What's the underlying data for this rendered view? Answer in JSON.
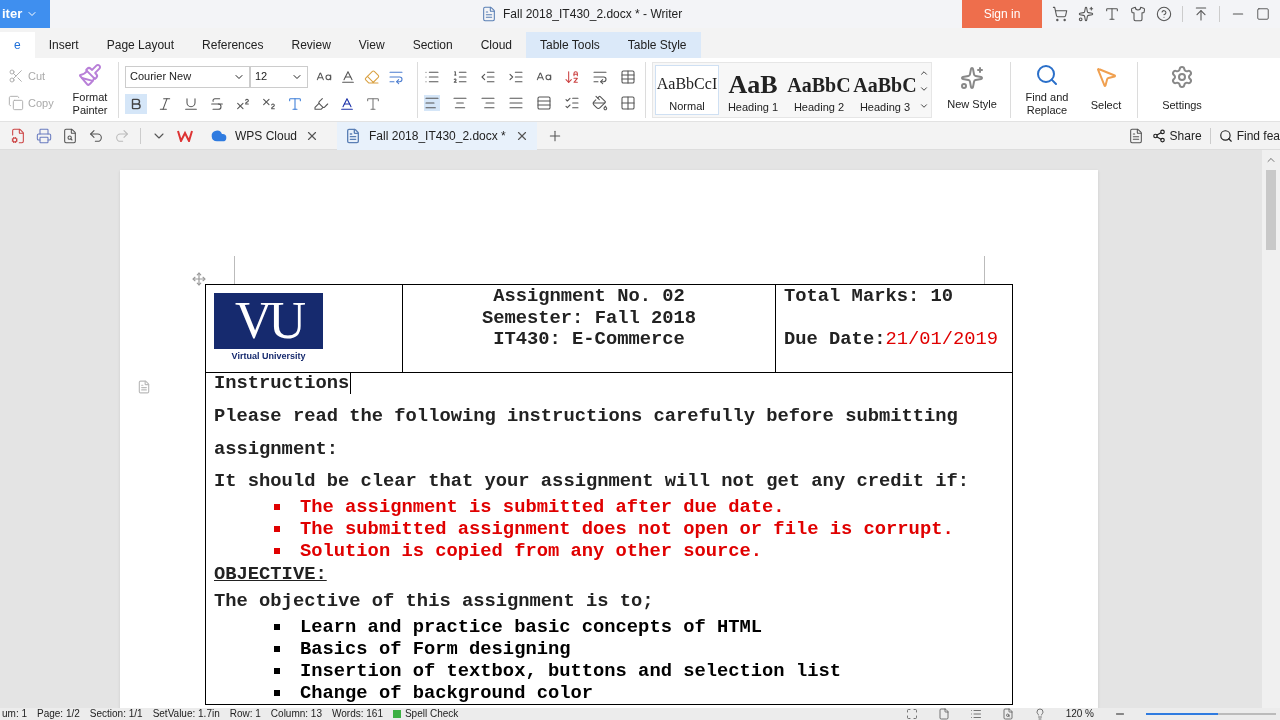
{
  "app_button": {
    "label": "iter"
  },
  "window": {
    "title": "Fall 2018_IT430_2.docx * - Writer",
    "sign_in": "Sign in"
  },
  "menu_tabs": [
    {
      "label": "e",
      "selected": true,
      "kind": "main"
    },
    {
      "label": "Insert",
      "selected": false,
      "kind": "main"
    },
    {
      "label": "Page Layout",
      "selected": false,
      "kind": "main"
    },
    {
      "label": "References",
      "selected": false,
      "kind": "main"
    },
    {
      "label": "Review",
      "selected": false,
      "kind": "main"
    },
    {
      "label": "View",
      "selected": false,
      "kind": "main"
    },
    {
      "label": "Section",
      "selected": false,
      "kind": "main"
    },
    {
      "label": "Cloud",
      "selected": false,
      "kind": "main"
    },
    {
      "label": "Table Tools",
      "selected": false,
      "kind": "context"
    },
    {
      "label": "Table Style",
      "selected": false,
      "kind": "context"
    }
  ],
  "ribbon": {
    "cut": {
      "label": "Cut",
      "disabled": true
    },
    "copy": {
      "label": "Copy",
      "disabled": true
    },
    "format_painter": "Format Painter",
    "font_name": "Courier New",
    "font_size": "12",
    "bold": {
      "selected": true
    },
    "styles": [
      {
        "preview": "AaBbCcI",
        "label": "Normal",
        "selected": true,
        "kind": "normal"
      },
      {
        "preview": "AaB",
        "label": "Heading 1",
        "selected": false,
        "kind": "h1"
      },
      {
        "preview": "AaBbC",
        "label": "Heading 2",
        "selected": false,
        "kind": "h2"
      },
      {
        "preview": "AaBbC",
        "label": "Heading 3",
        "selected": false,
        "kind": "h3"
      }
    ],
    "new_style": "New Style",
    "find_replace": "Find and Replace",
    "select": "Select",
    "settings": "Settings"
  },
  "doc_tabs": [
    {
      "label": "WPS Cloud",
      "selected": false
    },
    {
      "label": "Fall 2018_IT430_2.docx *",
      "selected": true
    }
  ],
  "share": "Share",
  "find": "Find fea",
  "document": {
    "logo": {
      "mark": "VU",
      "caption": "Virtual University"
    },
    "center_lines": [
      "Assignment No. 02",
      "Semester: Fall 2018",
      "IT430: E-Commerce"
    ],
    "total_marks": "Total Marks: 10",
    "due_label": "Due Date:",
    "due_value": "21/01/2019",
    "heading": "Instructions",
    "body": [
      {
        "kind": "para",
        "text": "Please read the following instructions carefully before submitting"
      },
      {
        "kind": "para",
        "text": "assignment:"
      },
      {
        "kind": "line",
        "text": "It should be clear that your assignment will not get any credit if:"
      },
      {
        "kind": "bullet",
        "text": "The assignment is submitted after due date.",
        "highlighted": true
      },
      {
        "kind": "bullet",
        "text": "The submitted assignment does not open or file is corrupt.",
        "highlighted": true
      },
      {
        "kind": "bullet",
        "text": "Solution is copied from any other source.",
        "highlighted": true
      },
      {
        "kind": "title",
        "text": "OBJECTIVE:"
      },
      {
        "kind": "line",
        "text": "The objective of this assignment is to;"
      },
      {
        "kind": "bullet",
        "text": "Learn and practice basic concepts of HTML",
        "highlighted": false
      },
      {
        "kind": "bullet",
        "text": "Basics of Form designing",
        "highlighted": false
      },
      {
        "kind": "bullet",
        "text": "Insertion of textbox, buttons and selection list",
        "highlighted": false
      },
      {
        "kind": "bullet",
        "text": "Change of background color",
        "highlighted": false
      }
    ]
  },
  "status_bar": {
    "items": [
      "um: 1",
      "Page: 1/2",
      "Section: 1/1",
      "SetValue: 1.7in",
      "Row: 1",
      "Column: 13",
      "Words: 161"
    ],
    "spell_check": "Spell Check",
    "zoom": "120 %",
    "zoom_level": {
      "level": 0.55
    }
  }
}
